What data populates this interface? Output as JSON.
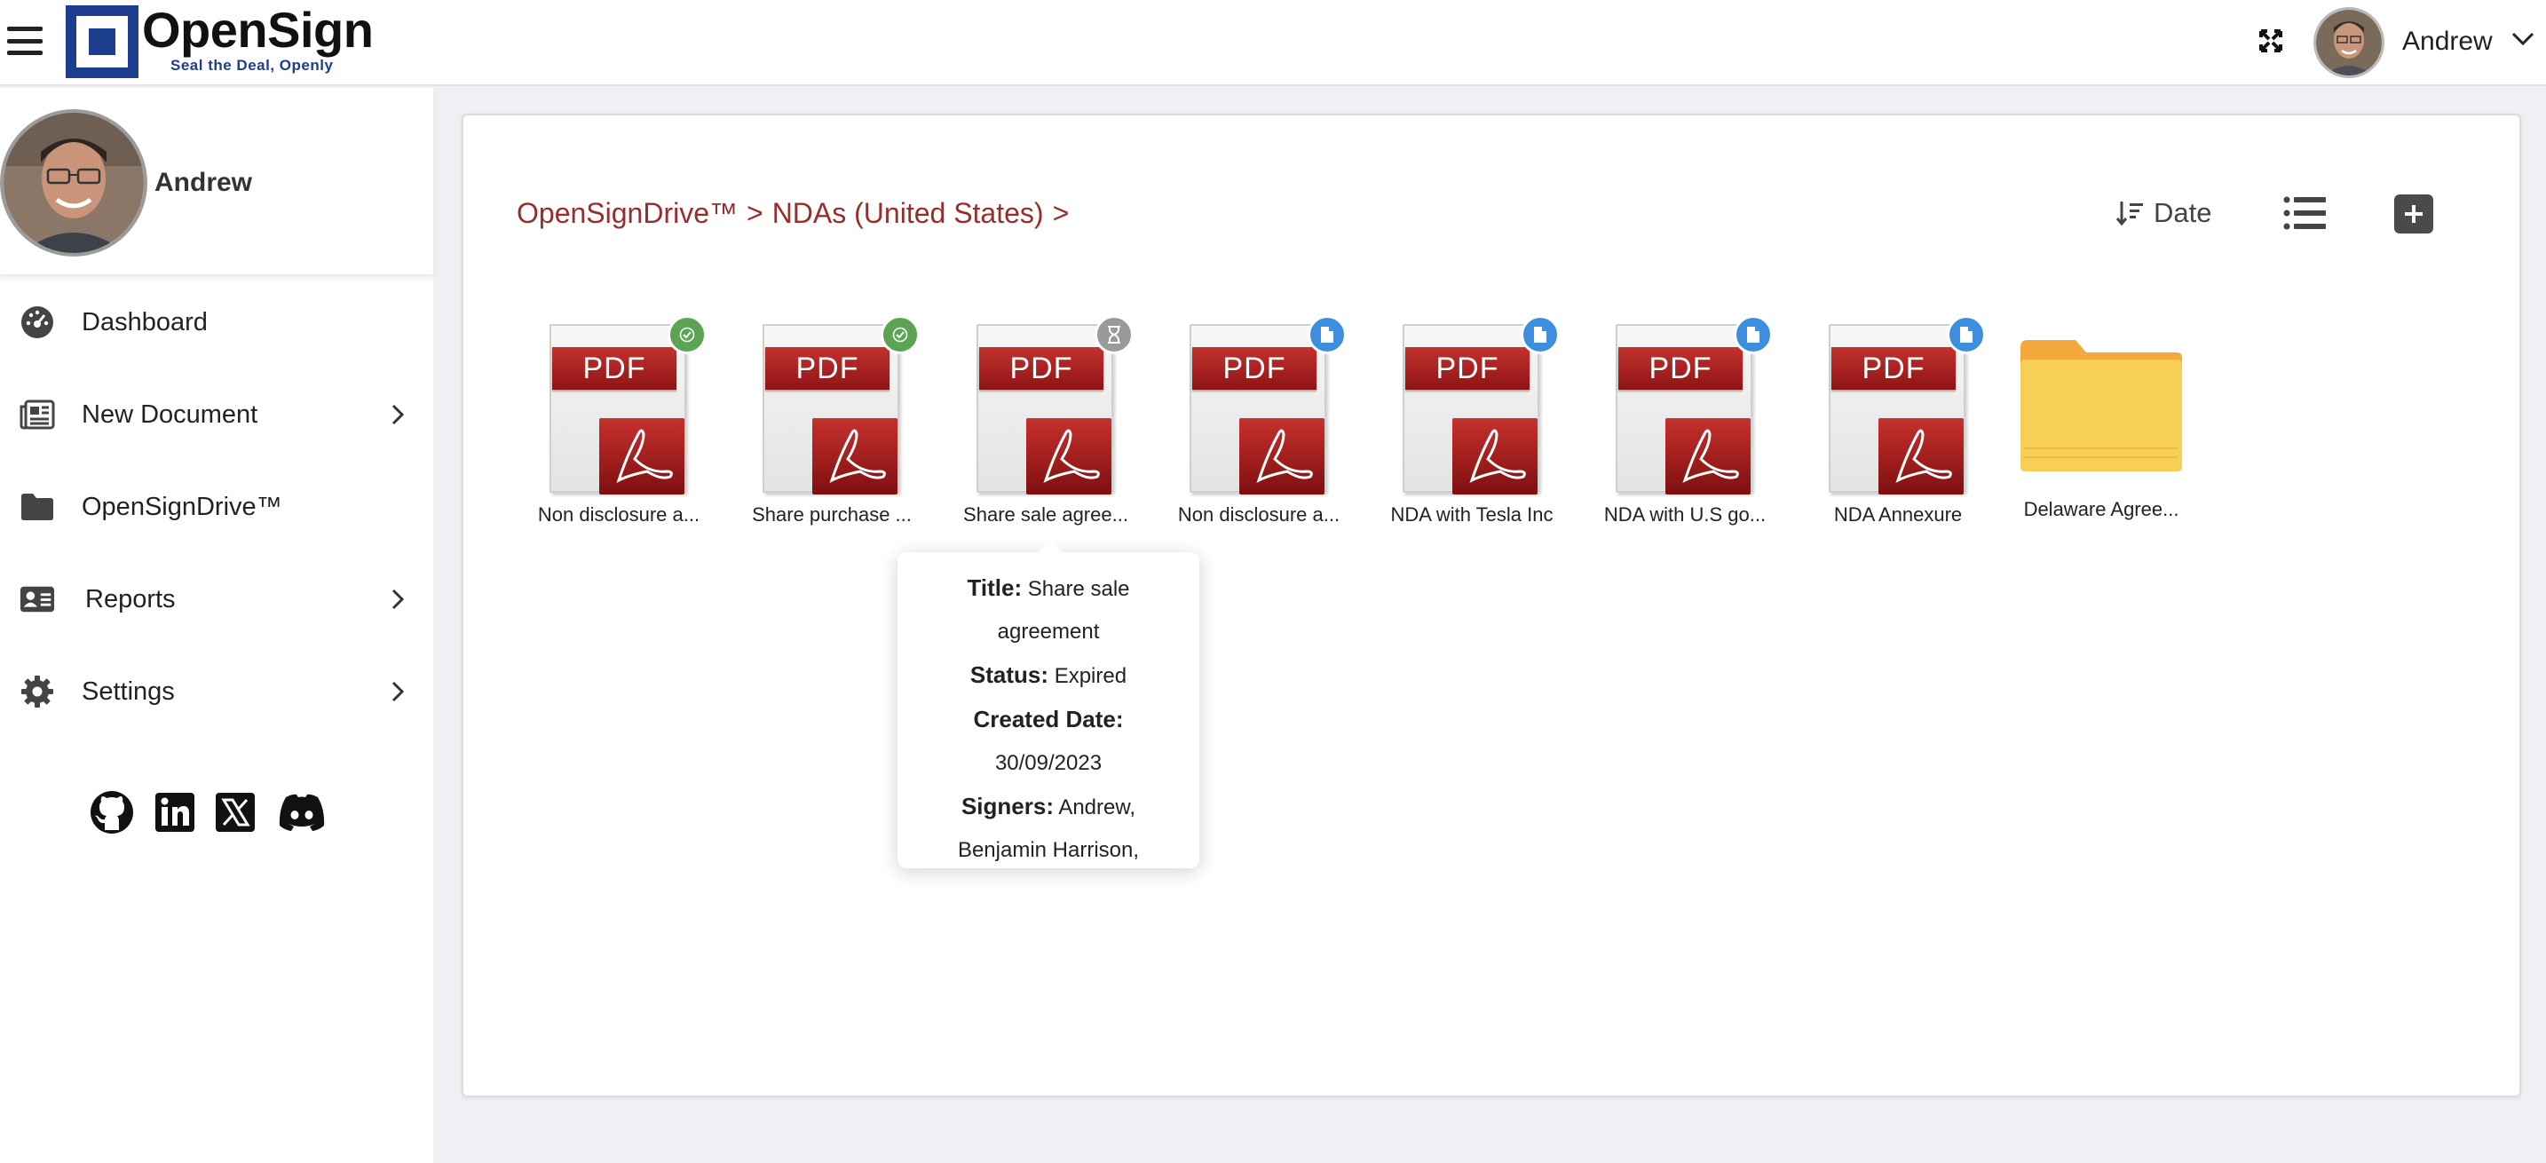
{
  "app": {
    "brand_name": "OpenSign",
    "brand_tagline": "Seal the Deal, Openly"
  },
  "topbar": {
    "user_name": "Andrew"
  },
  "sidebar": {
    "profile_name": "Andrew",
    "items": [
      {
        "label": "Dashboard",
        "icon": "dashboard-icon",
        "has_submenu": false
      },
      {
        "label": "New Document",
        "icon": "newspaper-icon",
        "has_submenu": true
      },
      {
        "label": "OpenSignDrive™",
        "icon": "folder-icon",
        "has_submenu": false
      },
      {
        "label": "Reports",
        "icon": "id-card-icon",
        "has_submenu": true
      },
      {
        "label": "Settings",
        "icon": "gear-icon",
        "has_submenu": true
      }
    ],
    "socials": [
      "github-icon",
      "linkedin-icon",
      "x-icon",
      "discord-icon"
    ]
  },
  "main": {
    "breadcrumb": [
      "OpenSignDrive™",
      ">",
      "NDAs (United States)",
      ">"
    ],
    "sort_label": "Date",
    "files": [
      {
        "name": "Non disclosure a...",
        "status_icon": "check-icon",
        "badge_color": "#5aa454"
      },
      {
        "name": "Share purchase ...",
        "status_icon": "check-icon",
        "badge_color": "#5aa454"
      },
      {
        "name": "Share sale agree...",
        "status_icon": "hourglass-icon",
        "badge_color": "#9a9a9a"
      },
      {
        "name": "Non disclosure a...",
        "status_icon": "file-icon",
        "badge_color": "#3d8ee0"
      },
      {
        "name": "NDA with Tesla Inc",
        "status_icon": "file-icon",
        "badge_color": "#3d8ee0"
      },
      {
        "name": "NDA with U.S go...",
        "status_icon": "file-icon",
        "badge_color": "#3d8ee0"
      },
      {
        "name": "NDA Annexure",
        "status_icon": "file-icon",
        "badge_color": "#3d8ee0"
      }
    ],
    "folders": [
      {
        "name": "Delaware Agree..."
      }
    ],
    "pdf_banner_text": "PDF"
  },
  "tooltip": {
    "title_label": "Title:",
    "title_value": "Share sale",
    "title_value_2": "agreement",
    "status_label": "Status:",
    "status_value": "Expired",
    "created_label": "Created Date:",
    "created_value": "30/09/2023",
    "signers_label": "Signers:",
    "signers_value": "Andrew,",
    "signers_value_2": "Benjamin Harrison,"
  },
  "colors": {
    "brand_blue": "#1d3d8f",
    "breadcrumb": "#9b2c2c",
    "badge_signed": "#5aa454",
    "badge_expired": "#9a9a9a",
    "badge_draft": "#3d8ee0",
    "folder": "#f6c94c"
  }
}
